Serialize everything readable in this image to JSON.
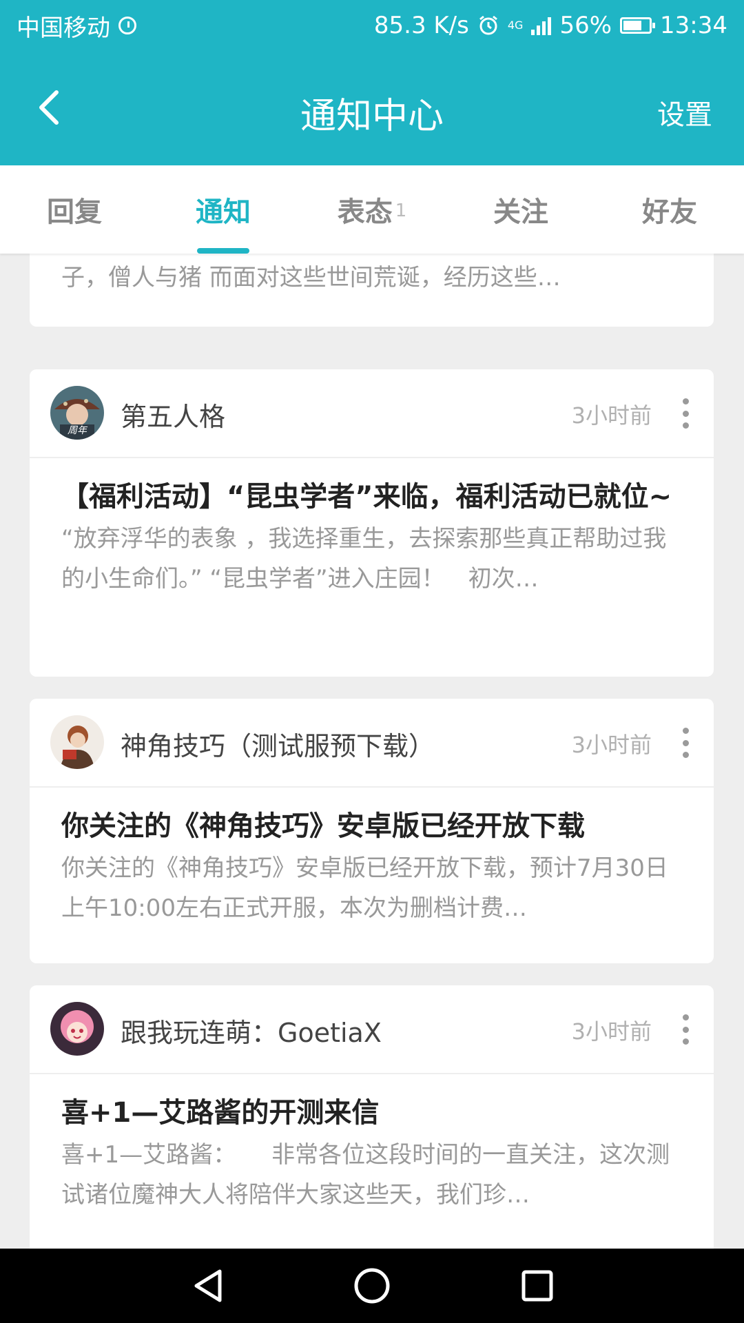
{
  "status_bar": {
    "carrier": "中国移动",
    "speed": "85.3 K/s",
    "network": "4G",
    "battery": "56%",
    "time": "13:34"
  },
  "header": {
    "title": "通知中心",
    "settings_label": "设置",
    "back_icon": "chevron-left-icon"
  },
  "tabs": [
    {
      "label": "回复",
      "active": false
    },
    {
      "label": "通知",
      "active": true
    },
    {
      "label": "表态",
      "badge": "1",
      "active": false
    },
    {
      "label": "关注",
      "active": false
    },
    {
      "label": "好友",
      "active": false
    }
  ],
  "cards": [
    {
      "excerpt": "长安夜萌，你却孤身向西 这次你的身后少了些白马 和猴子，僧人与猪 而面对这些世间荒诞，经历这些…"
    },
    {
      "sender": "第五人格",
      "avatar_label": "周年",
      "time": "3小时前",
      "headline": "【福利活动】“昆虫学者”来临，福利活动已就位~",
      "excerpt": "“放弃浮华的表象 ，我选择重生，去探索那些真正帮助过我的小生命们。” “昆虫学者”进入庄园！　初次…"
    },
    {
      "sender": "神角技巧（测试服预下载）",
      "time": "3小时前",
      "headline": "你关注的《神角技巧》安卓版已经开放下载",
      "excerpt": "你关注的《神角技巧》安卓版已经开放下载，预计7月30日上午10:00左右正式开服，本次为删档计费…"
    },
    {
      "sender": "跟我玩连萌：GoetiaX",
      "time": "3小时前",
      "headline": "喜+1—艾路酱的开测来信",
      "excerpt": "喜+1—艾路酱：　　非常各位这段时间的一直关注，这次测试诸位魔神大人将陪伴大家这些天，我们珍…"
    }
  ],
  "colors": {
    "accent": "#1fb5c5",
    "background": "#eeeeee",
    "card": "#ffffff"
  }
}
